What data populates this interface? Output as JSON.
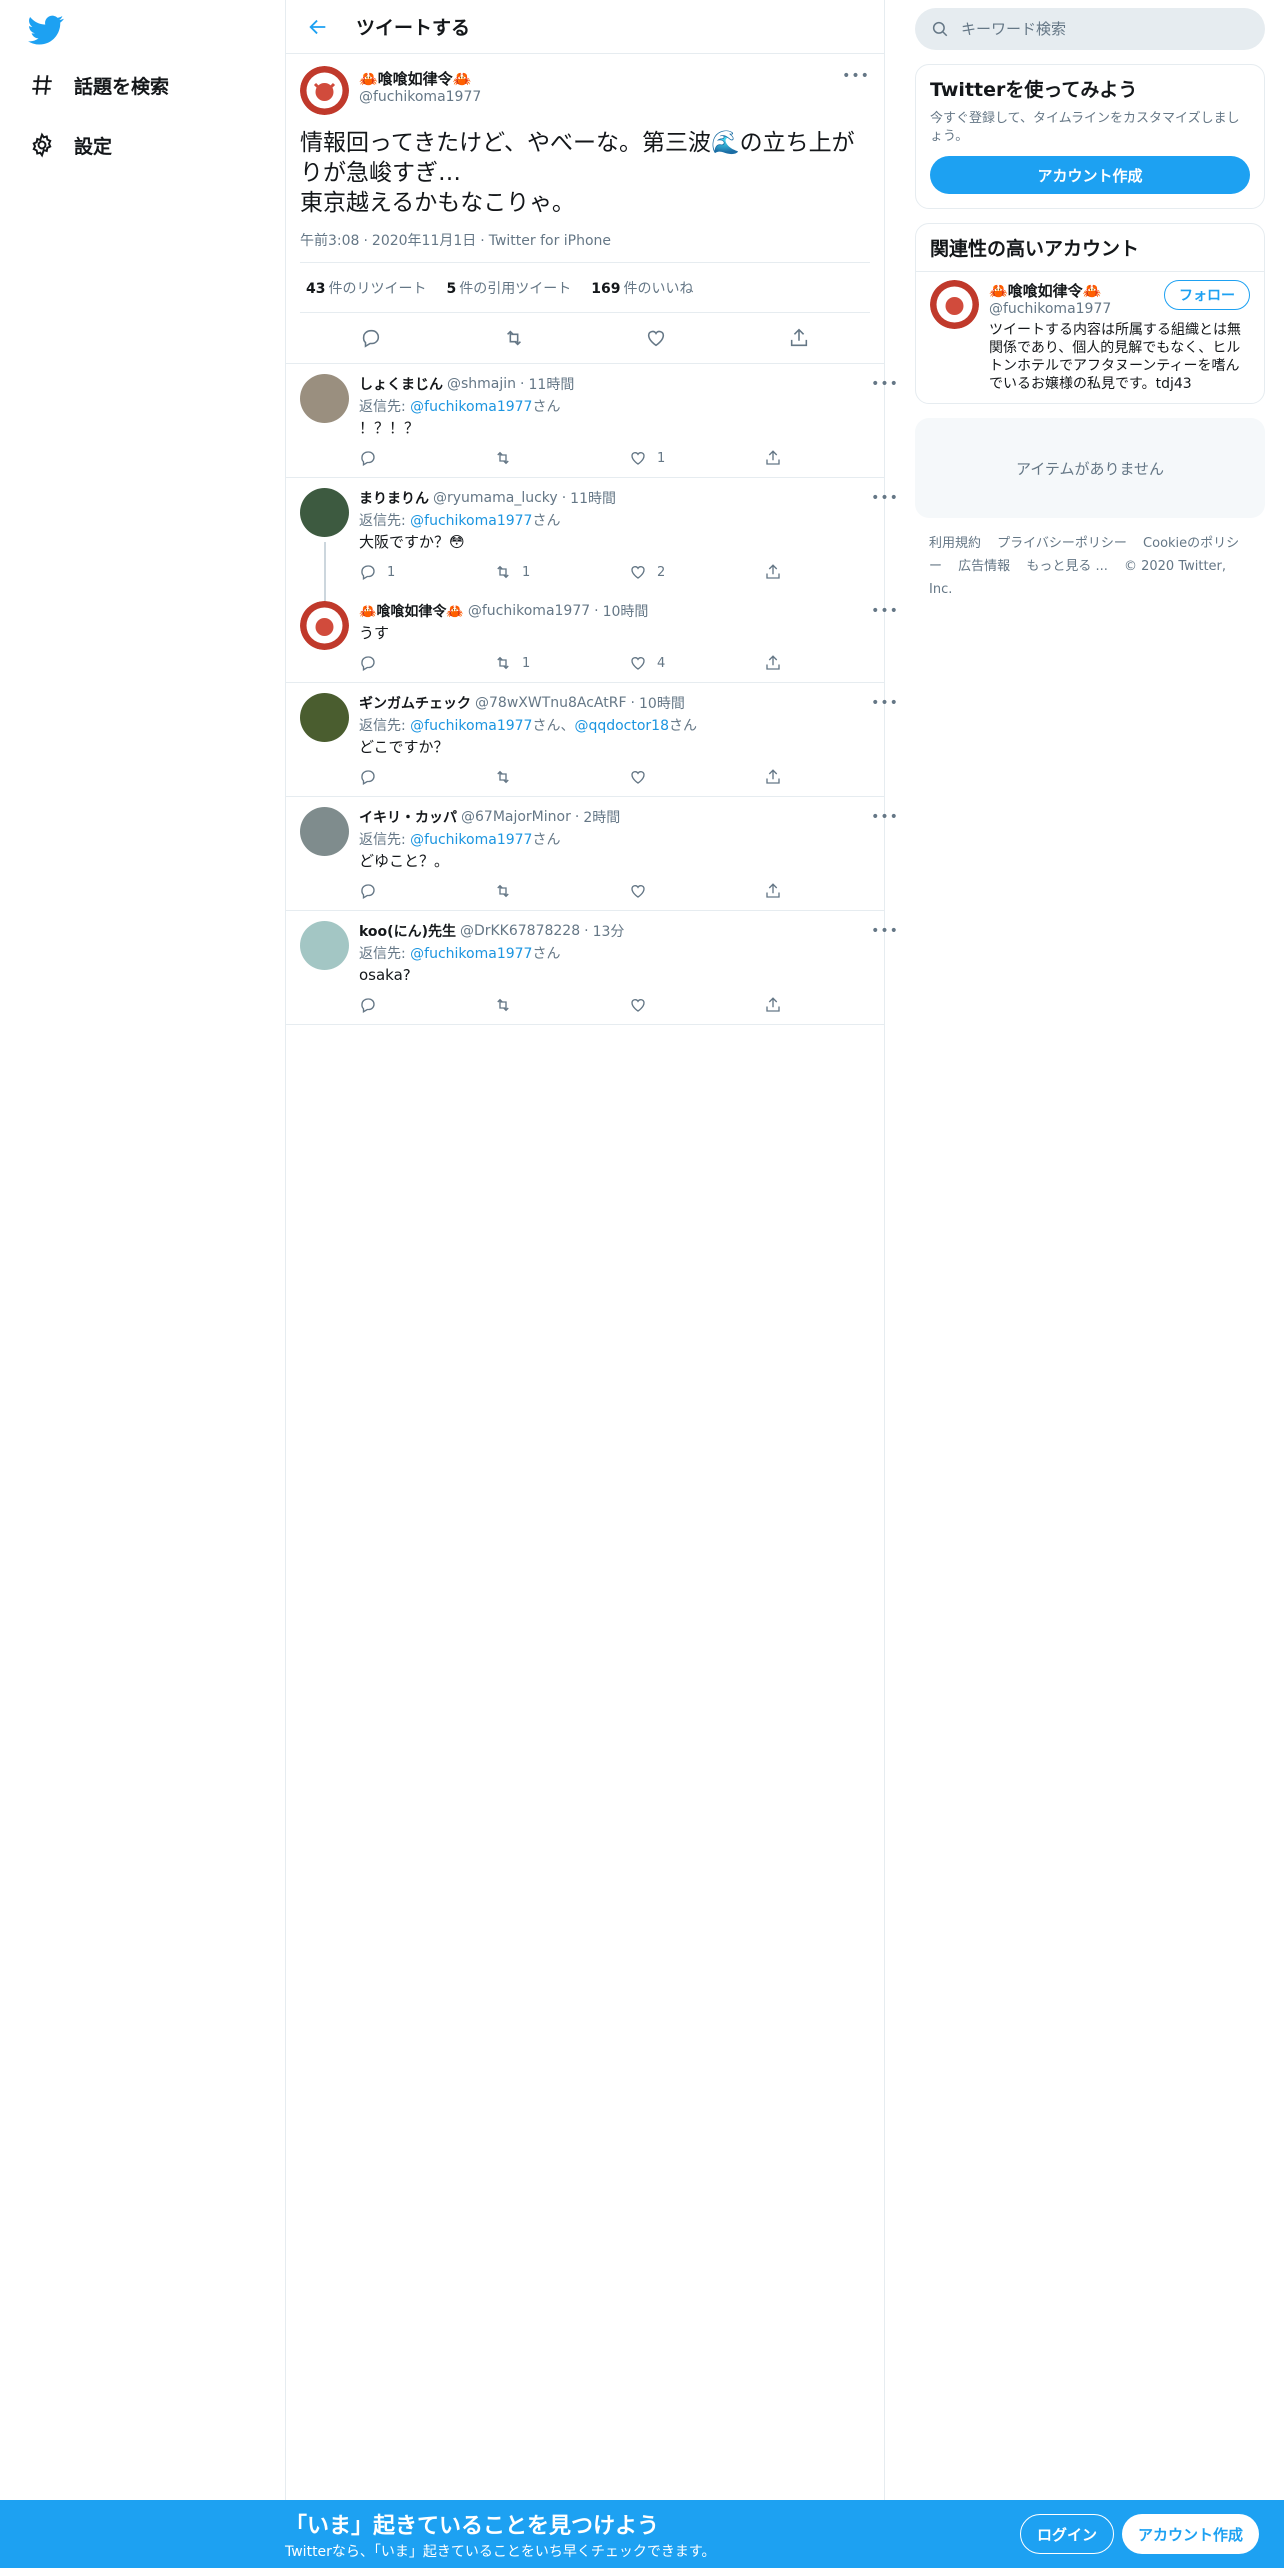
{
  "nav": {
    "logo_icon": "twitter-bird-icon",
    "items": [
      {
        "label": "話題を検索",
        "icon": "hashtag-icon"
      },
      {
        "label": "設定",
        "icon": "gear-icon"
      }
    ]
  },
  "header": {
    "title": "ツイートする",
    "back_icon": "arrow-left-icon"
  },
  "main_tweet": {
    "display_name": "🦀喰喰如律令🦀",
    "handle": "@fuchikoma1977",
    "text": "情報回ってきたけど、やべーな。第三波🌊の立ち上がりが急峻すぎ…\n東京越えるかもなこりゃ。",
    "time": "午前3:08",
    "date": "2020年11月1日",
    "source": "Twitter for iPhone",
    "stats": [
      {
        "count": "43",
        "label": "件のリツイート"
      },
      {
        "count": "5",
        "label": "件の引用ツイート"
      },
      {
        "count": "169",
        "label": "件のいいね"
      }
    ]
  },
  "replies": [
    {
      "name": "しょくまじん",
      "handle": "@shmajin",
      "time": "11時間",
      "reply_prefix": "返信先: ",
      "mentions": [
        {
          "handle": "@fuchikoma1977",
          "suffix": "さん"
        }
      ],
      "text": "！？！？",
      "counts": {
        "reply": "",
        "retweet": "",
        "like": "1"
      },
      "avatar_color": "#9a8f7f"
    },
    {
      "name": "まりまりん",
      "handle": "@ryumama_lucky",
      "time": "11時間",
      "reply_prefix": "返信先: ",
      "mentions": [
        {
          "handle": "@fuchikoma1977",
          "suffix": "さん"
        }
      ],
      "text": "大阪ですか？😳",
      "counts": {
        "reply": "1",
        "retweet": "1",
        "like": "2"
      },
      "avatar_color": "#3d5a40"
    },
    {
      "name": "🦀喰喰如律令🦀",
      "handle": "@fuchikoma1977",
      "time": "10時間",
      "reply_prefix": "",
      "mentions": [],
      "text": "うす",
      "counts": {
        "reply": "",
        "retweet": "1",
        "like": "4"
      },
      "avatar_color": "#c0392b"
    },
    {
      "name": "ギンガムチェック",
      "handle": "@78wXWTnu8AcAtRF",
      "time": "10時間",
      "reply_prefix": "返信先: ",
      "mentions": [
        {
          "handle": "@fuchikoma1977",
          "suffix": "さん、"
        },
        {
          "handle": "@qqdoctor18",
          "suffix": "さん"
        }
      ],
      "text": "どこですか？",
      "counts": {
        "reply": "",
        "retweet": "",
        "like": ""
      },
      "avatar_color": "#4a5d2f"
    },
    {
      "name": "イキリ・カッパ",
      "handle": "@67MajorMinor",
      "time": "2時間",
      "reply_prefix": "返信先: ",
      "mentions": [
        {
          "handle": "@fuchikoma1977",
          "suffix": "さん"
        }
      ],
      "text": "どゆこと？。",
      "counts": {
        "reply": "",
        "retweet": "",
        "like": ""
      },
      "avatar_color": "#7f8c8d"
    },
    {
      "name": "koo(にん)先生",
      "handle": "@DrKK67878228",
      "time": "13分",
      "reply_prefix": "返信先: ",
      "mentions": [
        {
          "handle": "@fuchikoma1977",
          "suffix": "さん"
        }
      ],
      "text": "osaka?",
      "counts": {
        "reply": "",
        "retweet": "",
        "like": ""
      },
      "avatar_color": "#a3c6c4"
    }
  ],
  "sidebar": {
    "search_placeholder": "キーワード検索",
    "signup_card": {
      "title": "Twitterを使ってみよう",
      "subtitle": "今すぐ登録して、タイムラインをカスタマイズしましょう。",
      "button": "アカウント作成"
    },
    "related": {
      "title": "関連性の高いアカウント",
      "name": "🦀喰喰如律令🦀",
      "handle": "@fuchikoma1977",
      "follow": "フォロー",
      "bio": "ツイートする内容は所属する組織とは無関係であり、個人的見解でもなく、ヒルトンホテルでアフタヌーンティーを嗜んでいるお嬢様の私見です。tdj43"
    },
    "empty": "アイテムがありません",
    "footer": [
      "利用規約",
      "プライバシーポリシー",
      "Cookieのポリシー",
      "広告情報",
      "もっと見る ...",
      "© 2020 Twitter, Inc."
    ]
  },
  "bottom_bar": {
    "title": "「いま」起きていることを見つけよう",
    "subtitle": "Twitterなら、「いま」起きていることをいち早くチェックできます。",
    "login": "ログイン",
    "signup": "アカウント作成"
  },
  "colors": {
    "accent": "#1da1f2",
    "link": "#1b95e0",
    "secondary_text": "#657786"
  }
}
